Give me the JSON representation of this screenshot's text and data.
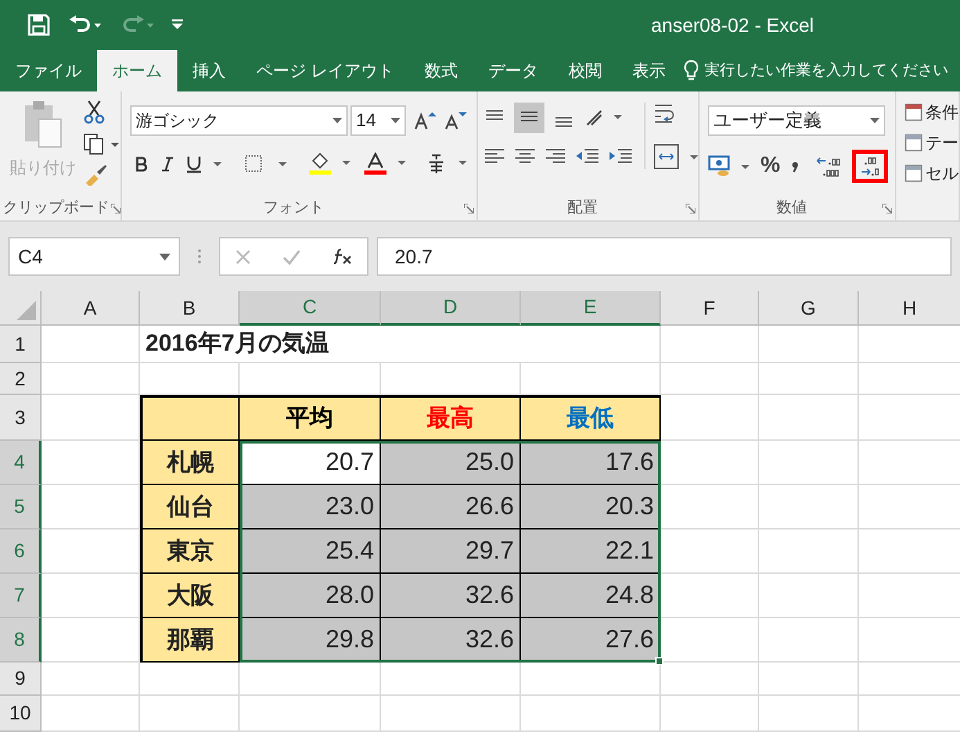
{
  "title_bar": {
    "title": "anser08-02  -  Excel"
  },
  "tabs": [
    {
      "label": "ファイル",
      "selected": false
    },
    {
      "label": "ホーム",
      "selected": true
    },
    {
      "label": "挿入",
      "selected": false
    },
    {
      "label": "ページ レイアウト",
      "selected": false
    },
    {
      "label": "数式",
      "selected": false
    },
    {
      "label": "データ",
      "selected": false
    },
    {
      "label": "校閲",
      "selected": false
    },
    {
      "label": "表示",
      "selected": false
    }
  ],
  "tell_me": "実行したい作業を入力してください",
  "ribbon": {
    "clipboard": {
      "paste": "貼り付け",
      "label": "クリップボード"
    },
    "font": {
      "name": "游ゴシック",
      "size": "14",
      "label": "フォント"
    },
    "alignment": {
      "label": "配置"
    },
    "number": {
      "format": "ユーザー定義",
      "percent": "%",
      "label": "数値",
      "decrease_decimal_highlighted": true
    },
    "styles": {
      "items": [
        "条件",
        "テー",
        "セル"
      ]
    }
  },
  "formula_bar": {
    "name_box": "C4",
    "value": "20.7"
  },
  "columns": [
    {
      "label": "A",
      "selected": false
    },
    {
      "label": "B",
      "selected": false
    },
    {
      "label": "C",
      "selected": true
    },
    {
      "label": "D",
      "selected": true
    },
    {
      "label": "E",
      "selected": true
    },
    {
      "label": "F",
      "selected": false
    },
    {
      "label": "G",
      "selected": false
    },
    {
      "label": "H",
      "selected": false
    }
  ],
  "row_headers": [
    {
      "label": "1",
      "selected": false
    },
    {
      "label": "2",
      "selected": false
    },
    {
      "label": "3",
      "selected": false
    },
    {
      "label": "4",
      "selected": true
    },
    {
      "label": "5",
      "selected": true
    },
    {
      "label": "6",
      "selected": true
    },
    {
      "label": "7",
      "selected": true
    },
    {
      "label": "8",
      "selected": true
    },
    {
      "label": "9",
      "selected": false
    },
    {
      "label": "10",
      "selected": false
    }
  ],
  "sheet": {
    "title": "2016年7月の気温",
    "table": {
      "headers": [
        {
          "label": "平均",
          "color": "#000000"
        },
        {
          "label": "最高",
          "color": "#ff0000"
        },
        {
          "label": "最低",
          "color": "#0070c0"
        }
      ],
      "rows": [
        {
          "label": "札幌",
          "values": [
            {
              "text": "20.7",
              "selected": true,
              "active": true
            },
            {
              "text": "25.0",
              "selected": true,
              "active": false
            },
            {
              "text": "17.6",
              "selected": true,
              "active": false
            }
          ]
        },
        {
          "label": "仙台",
          "values": [
            {
              "text": "23.0",
              "selected": true,
              "active": false
            },
            {
              "text": "26.6",
              "selected": true,
              "active": false
            },
            {
              "text": "20.3",
              "selected": true,
              "active": false
            }
          ]
        },
        {
          "label": "東京",
          "values": [
            {
              "text": "25.4",
              "selected": true,
              "active": false
            },
            {
              "text": "29.7",
              "selected": true,
              "active": false
            },
            {
              "text": "22.1",
              "selected": true,
              "active": false
            }
          ]
        },
        {
          "label": "大阪",
          "values": [
            {
              "text": "28.0",
              "selected": true,
              "active": false
            },
            {
              "text": "32.6",
              "selected": true,
              "active": false
            },
            {
              "text": "24.8",
              "selected": true,
              "active": false
            }
          ]
        },
        {
          "label": "那覇",
          "values": [
            {
              "text": "29.8",
              "selected": true,
              "active": false
            },
            {
              "text": "32.6",
              "selected": true,
              "active": false
            },
            {
              "text": "27.6",
              "selected": true,
              "active": false
            }
          ]
        }
      ]
    }
  }
}
